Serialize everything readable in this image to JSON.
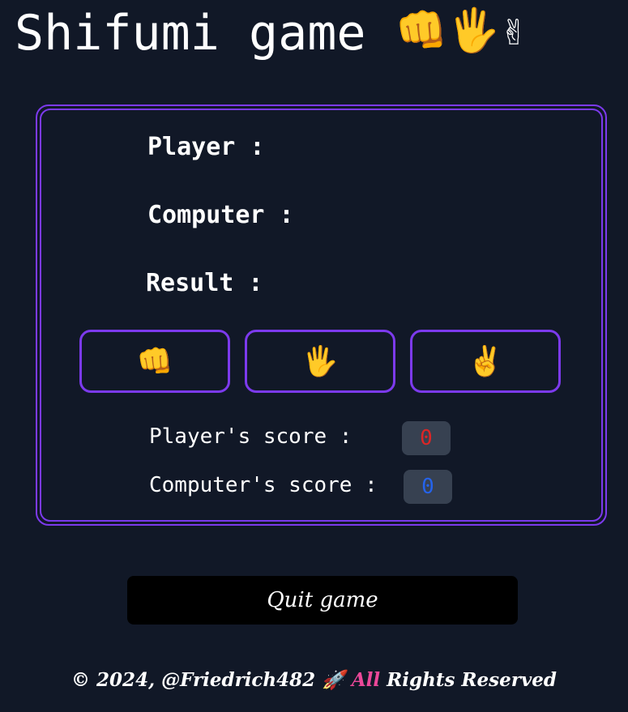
{
  "header": {
    "title": "Shifumi game",
    "emojis": [
      "👊",
      "🖐",
      "✌"
    ]
  },
  "game": {
    "player_label": "Player :",
    "player_value": "",
    "computer_label": "Computer :",
    "computer_value": "",
    "result_label": "Result :",
    "result_value": ""
  },
  "choices": [
    {
      "name": "rock",
      "emoji": "👊"
    },
    {
      "name": "paper",
      "emoji": "🖐"
    },
    {
      "name": "scissors",
      "emoji": "✌"
    }
  ],
  "scores": {
    "player_label": "Player's score :",
    "player_value": "0",
    "player_color": "#dc2626",
    "computer_label": "Computer's score :",
    "computer_value": "0",
    "computer_color": "#2563eb"
  },
  "quit_label": "Quit game",
  "footer": {
    "prefix": "© 2024, @Friedrich482 🚀 ",
    "highlight": "All",
    "suffix": " Rights Reserved"
  },
  "colors": {
    "background": "#111827",
    "accent": "#7c3aed",
    "score_bg": "#374151",
    "footer_highlight": "#ec4899"
  }
}
